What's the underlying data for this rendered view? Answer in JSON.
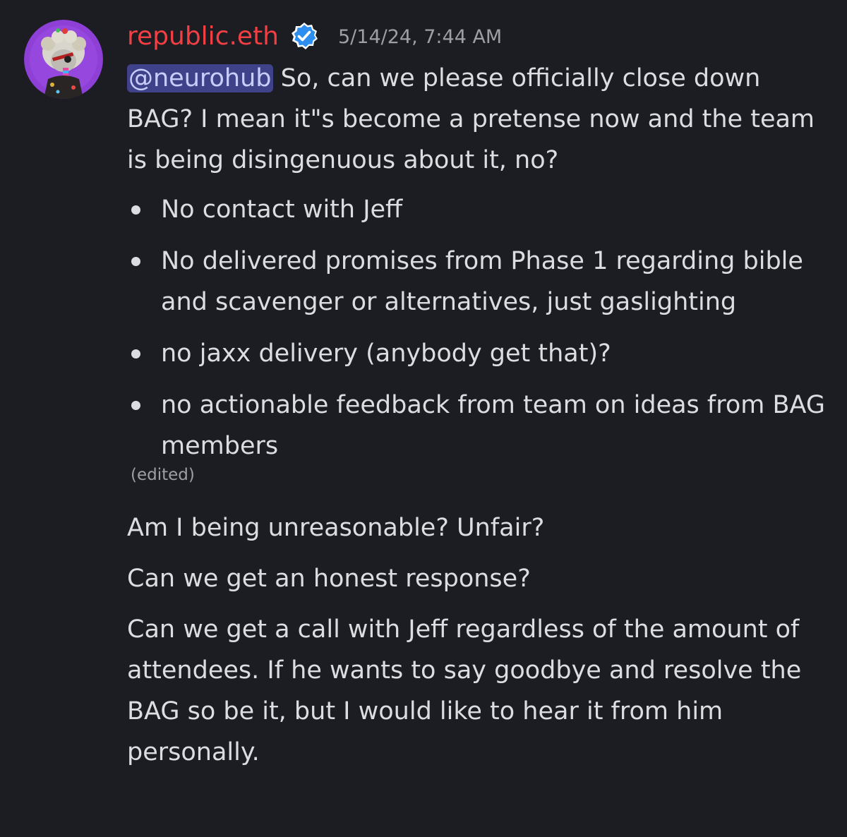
{
  "message": {
    "author": {
      "username": "republic.eth",
      "verified_icon": "verified-badge-icon",
      "avatar_icon": "avatar-image",
      "username_color": "#f23f43"
    },
    "timestamp": "5/14/24, 7:44 AM",
    "mention": "@neurohub",
    "intro_text": " So, can we please officially close down BAG? I mean it\"s become a pretense now and the team is being disingenuous about it, no?",
    "bullets": [
      "No contact with Jeff",
      "No delivered promises from Phase 1 regarding bible and scavenger or alternatives, just gaslighting",
      "no jaxx delivery (anybody get that)?",
      "no actionable feedback from team on ideas from BAG members"
    ],
    "edited_label": "(edited)",
    "followups": [
      "Am I being unreasonable? Unfair?",
      "Can we get an honest response?",
      "Can we get a call with Jeff regardless of the amount of attendees. If he wants to say goodbye and resolve the BAG so be it, but I would like to hear it from him personally."
    ]
  },
  "colors": {
    "background": "#1c1d22",
    "text": "#dcdde0",
    "muted": "#9d9fa6",
    "mention_bg": "#3f4288",
    "verified": "#2e8ef0"
  }
}
